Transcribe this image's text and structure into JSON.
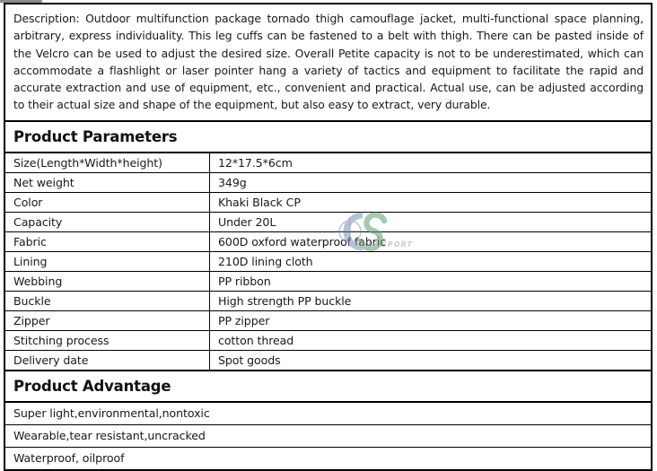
{
  "description": {
    "label": "Description:",
    "text": "Description: Outdoor multifunction package tornado thigh camouflage jacket, multi-functional space planning, arbitrary, express individuality. This leg cuffs can be fastened to a belt with thigh. There can be pasted inside of the Velcro can be used to adjust the desired size. Overall Petite capacity is not to be underestimated, which can accommodate a flashlight or laser pointer hang a variety of tactics and equipment to facilitate the rapid and accurate extraction and use of equipment, etc., convenient and practical. Actual use, can be adjusted according to their actual size and shape of the equipment, but also easy to extract, very durable."
  },
  "product_parameters": {
    "heading": "Product Parameters",
    "rows": [
      {
        "label": "Size(Length*Width*height)",
        "value": "12*17.5*6cm"
      },
      {
        "label": "Net weight",
        "value": "349g"
      },
      {
        "label": "Color",
        "value": "Khaki Black CP"
      },
      {
        "label": "Capacity",
        "value": "Under 20L"
      },
      {
        "label": "Fabric",
        "value": "600D oxford waterproof fabric"
      },
      {
        "label": "Lining",
        "value": "210D lining cloth"
      },
      {
        "label": "Webbing",
        "value": "PP ribbon"
      },
      {
        "label": "Buckle",
        "value": "High strength PP buckle"
      },
      {
        "label": "Zipper",
        "value": "PP zipper"
      },
      {
        "label": "Stitching process",
        "value": "cotton thread"
      },
      {
        "label": "Delivery date",
        "value": "Spot goods"
      }
    ]
  },
  "product_advantage": {
    "heading": "Product Advantage",
    "items": [
      "Super light,environmental,nontoxic",
      "Wearable,tear resistant,uncracked",
      "Waterproof, oilproof"
    ]
  },
  "watermark": {
    "brand_mark": "CS",
    "brand_text": "CANIS SPORT",
    "colors": {
      "c_letter": "#7a93b5",
      "s_letter": "#5f9e6e",
      "text": "#9aa0a6"
    }
  },
  "colors": {
    "border": "#000000",
    "text": "#191919",
    "background": "#ffffff"
  }
}
